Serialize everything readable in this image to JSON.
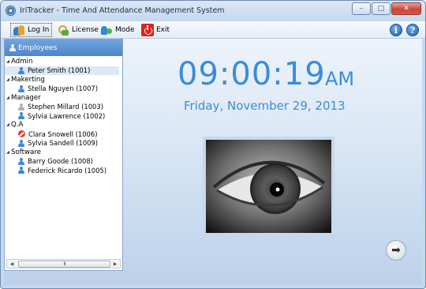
{
  "window": {
    "title": "IriTracker - Time And Attendance Management System",
    "minimize_icon": "minimize-icon",
    "maximize_icon": "maximize-icon",
    "close_icon": "close-icon"
  },
  "toolbar": {
    "login_label": "Log In",
    "license_label": "License",
    "mode_label": "Mode",
    "exit_label": "Exit",
    "info_glyph": "i",
    "help_glyph": "?"
  },
  "tree": {
    "header": "Employees",
    "groups": [
      {
        "name": "Admin",
        "employees": [
          {
            "name": "Peter Smith (1001)",
            "status": "active",
            "selected": true
          }
        ]
      },
      {
        "name": "Makerting",
        "employees": [
          {
            "name": "Stella Nguyen (1007)",
            "status": "active"
          }
        ]
      },
      {
        "name": "Manager",
        "employees": [
          {
            "name": "Stephen Millard (1003)",
            "status": "inactive"
          },
          {
            "name": "Sylvia Lawrence (1002)",
            "status": "active"
          }
        ]
      },
      {
        "name": "Q.A",
        "employees": [
          {
            "name": "Clara Snowell (1006)",
            "status": "blocked"
          },
          {
            "name": "Sylvia Sandell (1009)",
            "status": "active"
          }
        ]
      },
      {
        "name": "Software",
        "employees": [
          {
            "name": "Barry Goode (1008)",
            "status": "active"
          },
          {
            "name": "Federick Ricardo (1005)",
            "status": "active"
          }
        ]
      }
    ],
    "scroll_grip": "III"
  },
  "clock": {
    "time": "09:00:19",
    "ampm": "AM",
    "date": "Friday, November 29, 2013"
  },
  "iris_preview": {
    "icon": "eye-icon"
  },
  "next_button": {
    "glyph": "➡"
  },
  "colors": {
    "accent": "#3c8cd6",
    "header": "#5a8fd2",
    "close": "#c9473a"
  }
}
